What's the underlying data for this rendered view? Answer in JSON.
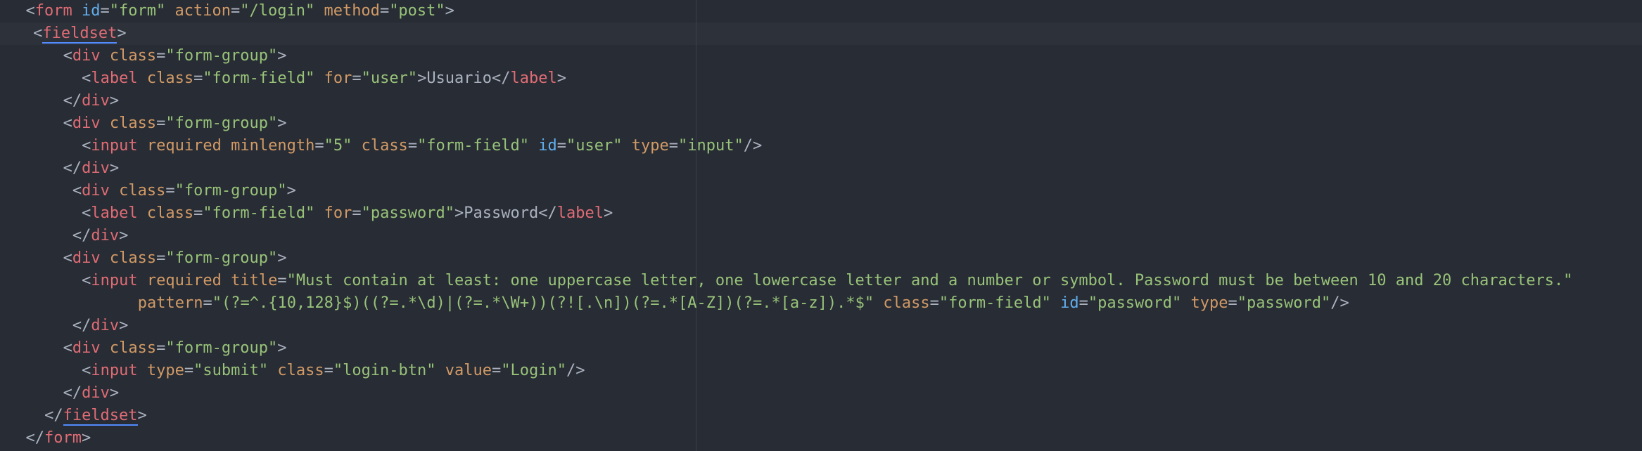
{
  "lines": [
    {
      "indent": 1,
      "tokens": [
        {
          "c": "p",
          "v": "<"
        },
        {
          "c": "t",
          "v": "form"
        },
        {
          "c": "x",
          "v": " "
        },
        {
          "c": "ai",
          "v": "id"
        },
        {
          "c": "p",
          "v": "="
        },
        {
          "c": "s",
          "v": "\"form\""
        },
        {
          "c": "x",
          "v": " "
        },
        {
          "c": "a",
          "v": "action"
        },
        {
          "c": "p",
          "v": "="
        },
        {
          "c": "s",
          "v": "\"/login\""
        },
        {
          "c": "x",
          "v": " "
        },
        {
          "c": "a",
          "v": "method"
        },
        {
          "c": "p",
          "v": "="
        },
        {
          "c": "s",
          "v": "\"post\""
        },
        {
          "c": "p",
          "v": ">"
        }
      ]
    },
    {
      "indent": 1.4,
      "tokens": [
        {
          "c": "p",
          "v": "<"
        },
        {
          "c": "t ul",
          "v": "fieldset"
        },
        {
          "c": "p",
          "v": ">"
        }
      ]
    },
    {
      "indent": 3,
      "tokens": [
        {
          "c": "p",
          "v": "<"
        },
        {
          "c": "t",
          "v": "div"
        },
        {
          "c": "x",
          "v": " "
        },
        {
          "c": "a",
          "v": "class"
        },
        {
          "c": "p",
          "v": "="
        },
        {
          "c": "s",
          "v": "\"form-group\""
        },
        {
          "c": "p",
          "v": ">"
        }
      ]
    },
    {
      "indent": 4,
      "tokens": [
        {
          "c": "p",
          "v": "<"
        },
        {
          "c": "t",
          "v": "label"
        },
        {
          "c": "x",
          "v": " "
        },
        {
          "c": "a",
          "v": "class"
        },
        {
          "c": "p",
          "v": "="
        },
        {
          "c": "s",
          "v": "\"form-field\""
        },
        {
          "c": "x",
          "v": " "
        },
        {
          "c": "a",
          "v": "for"
        },
        {
          "c": "p",
          "v": "="
        },
        {
          "c": "s",
          "v": "\"user\""
        },
        {
          "c": "p",
          "v": ">"
        },
        {
          "c": "x",
          "v": "Usuario"
        },
        {
          "c": "p",
          "v": "</"
        },
        {
          "c": "t",
          "v": "label"
        },
        {
          "c": "p",
          "v": ">"
        }
      ]
    },
    {
      "indent": 3,
      "tokens": [
        {
          "c": "p",
          "v": "</"
        },
        {
          "c": "t",
          "v": "div"
        },
        {
          "c": "p",
          "v": ">"
        }
      ]
    },
    {
      "indent": 3,
      "tokens": [
        {
          "c": "p",
          "v": "<"
        },
        {
          "c": "t",
          "v": "div"
        },
        {
          "c": "x",
          "v": " "
        },
        {
          "c": "a",
          "v": "class"
        },
        {
          "c": "p",
          "v": "="
        },
        {
          "c": "s",
          "v": "\"form-group\""
        },
        {
          "c": "p",
          "v": ">"
        }
      ]
    },
    {
      "indent": 4,
      "tokens": [
        {
          "c": "p",
          "v": "<"
        },
        {
          "c": "t",
          "v": "input"
        },
        {
          "c": "x",
          "v": " "
        },
        {
          "c": "a",
          "v": "required"
        },
        {
          "c": "x",
          "v": " "
        },
        {
          "c": "a",
          "v": "minlength"
        },
        {
          "c": "p",
          "v": "="
        },
        {
          "c": "s",
          "v": "\"5\""
        },
        {
          "c": "x",
          "v": " "
        },
        {
          "c": "a",
          "v": "class"
        },
        {
          "c": "p",
          "v": "="
        },
        {
          "c": "s",
          "v": "\"form-field\""
        },
        {
          "c": "x",
          "v": " "
        },
        {
          "c": "ai",
          "v": "id"
        },
        {
          "c": "p",
          "v": "="
        },
        {
          "c": "s",
          "v": "\"user\""
        },
        {
          "c": "x",
          "v": " "
        },
        {
          "c": "a",
          "v": "type"
        },
        {
          "c": "p",
          "v": "="
        },
        {
          "c": "s",
          "v": "\"input\""
        },
        {
          "c": "p",
          "v": "/>"
        }
      ]
    },
    {
      "indent": 3,
      "tokens": [
        {
          "c": "p",
          "v": "</"
        },
        {
          "c": "t",
          "v": "div"
        },
        {
          "c": "p",
          "v": ">"
        }
      ]
    },
    {
      "indent": 3.5,
      "tokens": [
        {
          "c": "p",
          "v": "<"
        },
        {
          "c": "t",
          "v": "div"
        },
        {
          "c": "x",
          "v": " "
        },
        {
          "c": "a",
          "v": "class"
        },
        {
          "c": "p",
          "v": "="
        },
        {
          "c": "s",
          "v": "\"form-group\""
        },
        {
          "c": "p",
          "v": ">"
        }
      ]
    },
    {
      "indent": 4,
      "tokens": [
        {
          "c": "p",
          "v": "<"
        },
        {
          "c": "t",
          "v": "label"
        },
        {
          "c": "x",
          "v": " "
        },
        {
          "c": "a",
          "v": "class"
        },
        {
          "c": "p",
          "v": "="
        },
        {
          "c": "s",
          "v": "\"form-field\""
        },
        {
          "c": "x",
          "v": " "
        },
        {
          "c": "a",
          "v": "for"
        },
        {
          "c": "p",
          "v": "="
        },
        {
          "c": "s",
          "v": "\"password\""
        },
        {
          "c": "p",
          "v": ">"
        },
        {
          "c": "x",
          "v": "Password"
        },
        {
          "c": "p",
          "v": "</"
        },
        {
          "c": "t",
          "v": "label"
        },
        {
          "c": "p",
          "v": ">"
        }
      ]
    },
    {
      "indent": 3.5,
      "tokens": [
        {
          "c": "p",
          "v": "</"
        },
        {
          "c": "t",
          "v": "div"
        },
        {
          "c": "p",
          "v": ">"
        }
      ]
    },
    {
      "indent": 3,
      "tokens": [
        {
          "c": "p",
          "v": "<"
        },
        {
          "c": "t",
          "v": "div"
        },
        {
          "c": "x",
          "v": " "
        },
        {
          "c": "a",
          "v": "class"
        },
        {
          "c": "p",
          "v": "="
        },
        {
          "c": "s",
          "v": "\"form-group\""
        },
        {
          "c": "p",
          "v": ">"
        }
      ]
    },
    {
      "indent": 4,
      "tokens": [
        {
          "c": "p",
          "v": "<"
        },
        {
          "c": "t",
          "v": "input"
        },
        {
          "c": "x",
          "v": " "
        },
        {
          "c": "a",
          "v": "required"
        },
        {
          "c": "x",
          "v": " "
        },
        {
          "c": "a",
          "v": "title"
        },
        {
          "c": "p",
          "v": "="
        },
        {
          "c": "s",
          "v": "\"Must contain at least: one uppercase letter, one lowercase letter and a number or symbol. Password must be between 10 and 20 characters.\""
        }
      ]
    },
    {
      "indent": 7,
      "tokens": [
        {
          "c": "a",
          "v": "pattern"
        },
        {
          "c": "p",
          "v": "="
        },
        {
          "c": "s",
          "v": "\"(?=^.{10,128}$)((?=.*\\d)|(?=.*\\W+))(?![.\\n])(?=.*[A-Z])(?=.*[a-z]).*$\""
        },
        {
          "c": "x",
          "v": " "
        },
        {
          "c": "a",
          "v": "class"
        },
        {
          "c": "p",
          "v": "="
        },
        {
          "c": "s",
          "v": "\"form-field\""
        },
        {
          "c": "x",
          "v": " "
        },
        {
          "c": "ai",
          "v": "id"
        },
        {
          "c": "p",
          "v": "="
        },
        {
          "c": "s",
          "v": "\"password\""
        },
        {
          "c": "x",
          "v": " "
        },
        {
          "c": "a",
          "v": "type"
        },
        {
          "c": "p",
          "v": "="
        },
        {
          "c": "s",
          "v": "\"password\""
        },
        {
          "c": "p",
          "v": "/>"
        }
      ]
    },
    {
      "indent": 3.5,
      "tokens": [
        {
          "c": "p",
          "v": "</"
        },
        {
          "c": "t",
          "v": "div"
        },
        {
          "c": "p",
          "v": ">"
        }
      ]
    },
    {
      "indent": 3,
      "tokens": [
        {
          "c": "p",
          "v": "<"
        },
        {
          "c": "t",
          "v": "div"
        },
        {
          "c": "x",
          "v": " "
        },
        {
          "c": "a",
          "v": "class"
        },
        {
          "c": "p",
          "v": "="
        },
        {
          "c": "s",
          "v": "\"form-group\""
        },
        {
          "c": "p",
          "v": ">"
        }
      ]
    },
    {
      "indent": 4,
      "tokens": [
        {
          "c": "p",
          "v": "<"
        },
        {
          "c": "t",
          "v": "input"
        },
        {
          "c": "x",
          "v": " "
        },
        {
          "c": "a",
          "v": "type"
        },
        {
          "c": "p",
          "v": "="
        },
        {
          "c": "s",
          "v": "\"submit\""
        },
        {
          "c": "x",
          "v": " "
        },
        {
          "c": "a",
          "v": "class"
        },
        {
          "c": "p",
          "v": "="
        },
        {
          "c": "s",
          "v": "\"login-btn\""
        },
        {
          "c": "x",
          "v": " "
        },
        {
          "c": "a",
          "v": "value"
        },
        {
          "c": "p",
          "v": "="
        },
        {
          "c": "s",
          "v": "\"Login\""
        },
        {
          "c": "p",
          "v": "/>"
        }
      ]
    },
    {
      "indent": 3,
      "tokens": [
        {
          "c": "p",
          "v": "</"
        },
        {
          "c": "t",
          "v": "div"
        },
        {
          "c": "p",
          "v": ">"
        }
      ]
    },
    {
      "indent": 2,
      "tokens": [
        {
          "c": "p",
          "v": "</"
        },
        {
          "c": "t ul",
          "v": "fieldset"
        },
        {
          "c": "p",
          "v": ">"
        }
      ]
    },
    {
      "indent": 1,
      "tokens": [
        {
          "c": "p",
          "v": "</"
        },
        {
          "c": "t",
          "v": "form"
        },
        {
          "c": "p",
          "v": ">"
        }
      ]
    }
  ]
}
